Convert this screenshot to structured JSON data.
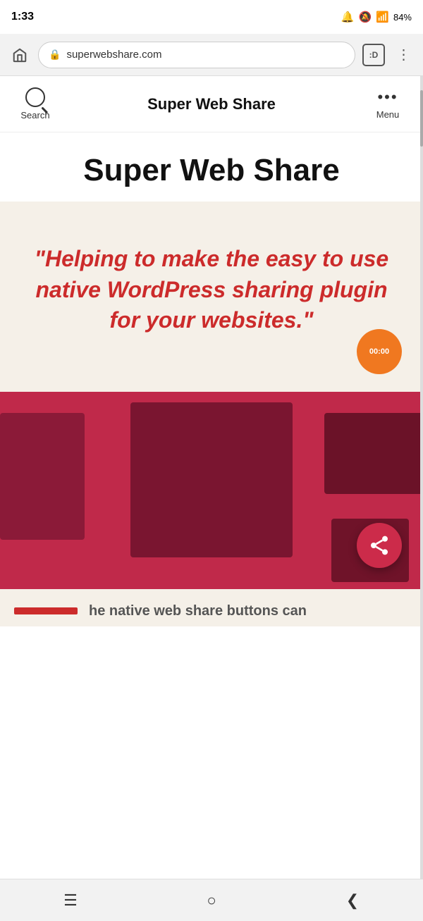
{
  "status_bar": {
    "time": "1:33",
    "battery": "84%",
    "icons": "🔔🔕📶"
  },
  "browser": {
    "url": "superwebshare.com",
    "tab_count": ":D",
    "home_icon": "🏠",
    "lock_icon": "🔒"
  },
  "site_header": {
    "search_label": "Search",
    "title": "Super Web Share",
    "menu_label": "Menu"
  },
  "hero": {
    "heading": "Super Web Share"
  },
  "quote": {
    "text": "\"Helping to make the easy to use native WordPress sharing plugin for your websites.\"",
    "timer": "00:00"
  },
  "bottom_preview": {
    "text": "he native web share buttons can"
  },
  "nav": {
    "back_icon": "❮",
    "home_icon": "○",
    "menu_icon": "☰"
  }
}
